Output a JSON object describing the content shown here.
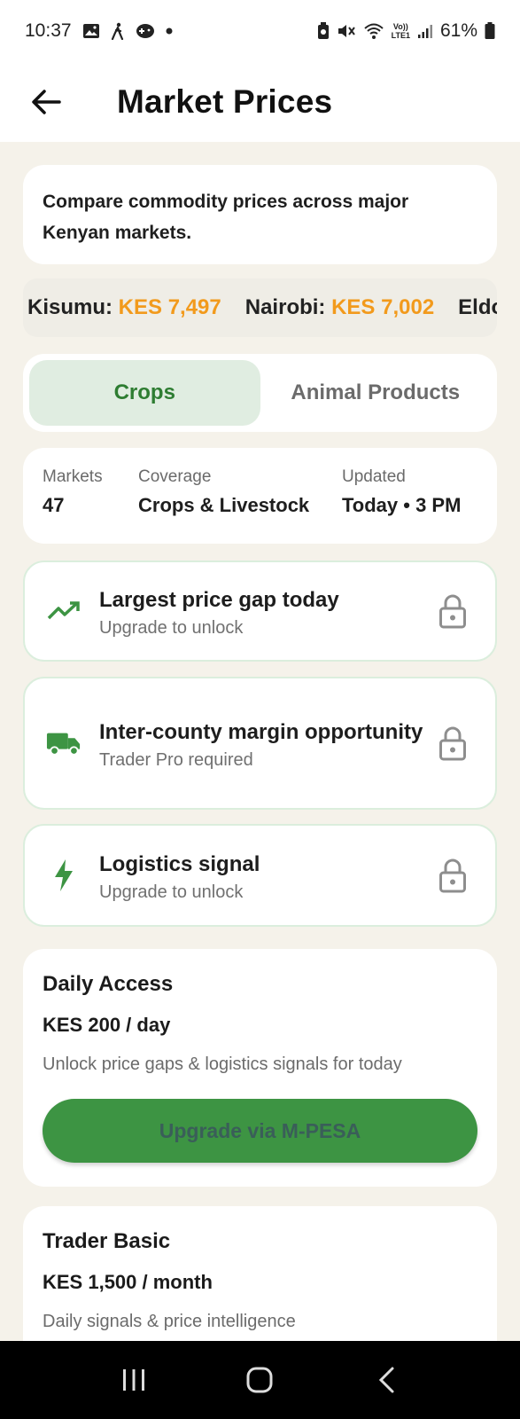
{
  "status_bar": {
    "time": "10:37",
    "battery_percent": "61%",
    "network": "LTE1",
    "left_icons": [
      "image-icon",
      "walking-icon",
      "game-icon",
      "dot-icon"
    ],
    "right_icons": [
      "battery-saver-icon",
      "mute-icon",
      "wifi-icon",
      "volte-icon",
      "signal-icon",
      "battery-icon"
    ]
  },
  "header": {
    "title": "Market Prices"
  },
  "intro": {
    "text": "Compare commodity prices across major Kenyan markets."
  },
  "ticker": [
    {
      "market": "Kisumu:",
      "price": "KES 7,497"
    },
    {
      "market": "Nairobi:",
      "price": "KES 7,002"
    },
    {
      "market": "Eldoret",
      "price": ""
    }
  ],
  "tabs": [
    {
      "label": "Crops",
      "active": true
    },
    {
      "label": "Animal Products",
      "active": false
    }
  ],
  "stats": {
    "markets_label": "Markets",
    "markets_value": "47",
    "coverage_label": "Coverage",
    "coverage_value": "Crops & Livestock",
    "updated_label": "Updated",
    "updated_value": "Today • 3 PM"
  },
  "features": [
    {
      "title": "Largest price gap today",
      "subtitle": "Upgrade to unlock",
      "icon": "trending-up-icon"
    },
    {
      "title": "Inter-county margin opportunity",
      "subtitle": "Trader Pro required",
      "icon": "truck-icon"
    },
    {
      "title": "Logistics signal",
      "subtitle": "Upgrade to unlock",
      "icon": "lightning-icon"
    }
  ],
  "plans": [
    {
      "title": "Daily Access",
      "price": "KES 200 / day",
      "description": "Unlock price gaps & logistics signals for today",
      "button": "Upgrade via M-PESA"
    },
    {
      "title": "Trader Basic",
      "price": "KES 1,500 / month",
      "description": "Daily signals & price intelligence"
    }
  ],
  "colors": {
    "accent_green": "#3d9443",
    "price_orange": "#f29a1c",
    "active_tab_bg": "#e0ede1",
    "background": "#f5f2ea"
  }
}
